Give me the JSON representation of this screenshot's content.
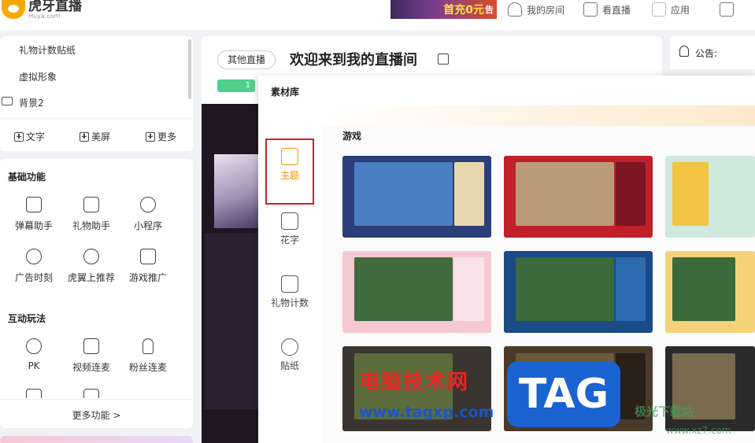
{
  "header": {
    "logo_text": "虎牙直播",
    "logo_sub": "Huya.com",
    "ad_text": "首充0元",
    "ad_small": "告",
    "nav": [
      "我的房间",
      "看直播",
      "应用"
    ]
  },
  "left_panel": {
    "layers": [
      "礼物计数贴纸",
      "虚拟形象",
      "背景2"
    ],
    "add_buttons": [
      "文字",
      "美屏",
      "更多"
    ],
    "basic_title": "基础功能",
    "basic_items": [
      "弹幕助手",
      "礼物助手",
      "小程序",
      "广告时刻",
      "虎翼上推荐",
      "游戏推广"
    ],
    "interactive_title": "互动玩法",
    "interactive_items": [
      "PK",
      "视频连麦",
      "粉丝连麦"
    ],
    "more_functions": "更多功能 >"
  },
  "room": {
    "category_tag": "其他直播",
    "title": "欢迎来到我的直播间",
    "level_badge": "1"
  },
  "notice": {
    "label": "公告:"
  },
  "library": {
    "title": "素材库",
    "tabs": [
      {
        "label": "主题",
        "active": true
      },
      {
        "label": "花字",
        "active": false
      },
      {
        "label": "礼物计数",
        "active": false
      },
      {
        "label": "贴纸",
        "active": false
      }
    ],
    "category": "游戏",
    "accent_color": "#ff8a00",
    "highlight_color": "#d42020"
  },
  "watermark": {
    "site_cn": "电脑技术网",
    "site_url": "www.tagxp.com",
    "tag": "TAG",
    "site2_cn": "极光下载站",
    "site2_url": "www.xz7.com"
  }
}
